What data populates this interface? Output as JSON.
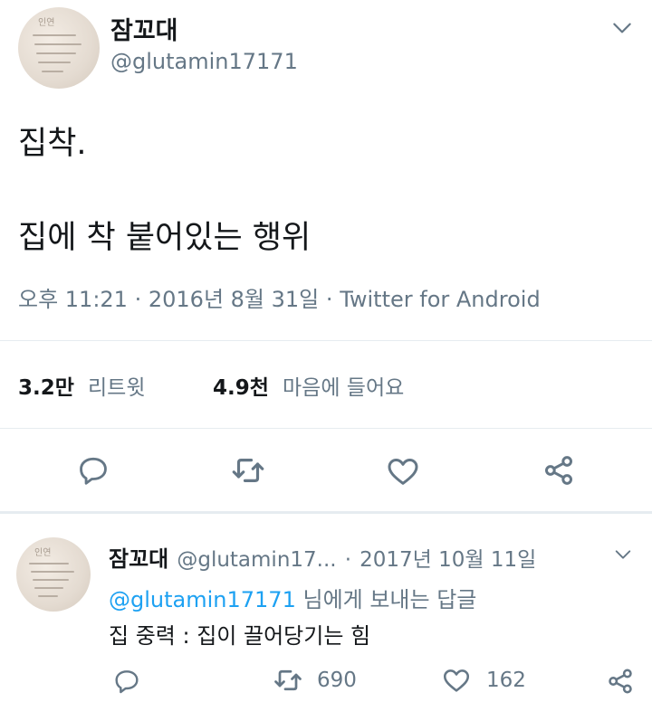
{
  "tweet": {
    "author": {
      "name": "잠꼬대",
      "handle": "@glutamin17171"
    },
    "lines": [
      "집착.",
      "집에 착 붙어있는 행위"
    ],
    "time": "오후 11:21",
    "date": "2016년 8월 31일",
    "source": "Twitter for Android",
    "separator": "·",
    "retweets": {
      "count": "3.2만",
      "label": "리트윗"
    },
    "likes": {
      "count": "4.9천",
      "label": "마음에 들어요"
    }
  },
  "reply": {
    "author": {
      "name": "잠꼬대",
      "handle": "@glutamin17..."
    },
    "separator": "·",
    "date": "2017년 10월 11일",
    "reply_to_handle": "@glutamin17171",
    "reply_to_suffix": "님에게 보내는 답글",
    "text": "집 중력 : 집이 끌어당기는 힘",
    "retweet_count": "690",
    "like_count": "162"
  },
  "colors": {
    "accent": "#1da1f2",
    "secondary": "#657786",
    "divider": "#e6ecf0"
  },
  "icons": [
    "chevron-down-icon",
    "reply-icon",
    "retweet-icon",
    "heart-icon",
    "share-icon"
  ]
}
